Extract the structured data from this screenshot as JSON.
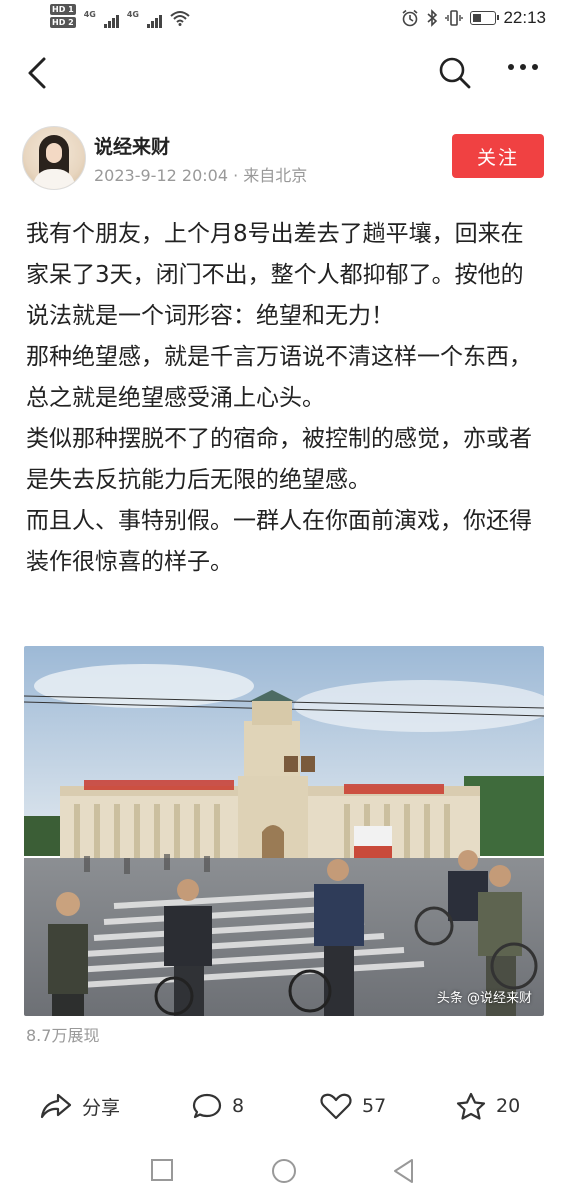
{
  "status_bar": {
    "sim1": "HD 1",
    "sim2": "HD 2",
    "network1": "4G",
    "network2": "4G",
    "time": "22:13"
  },
  "author": {
    "name": "说经来财",
    "meta": "2023-9-12 20:04 · 来自北京",
    "follow_label": "关注"
  },
  "post": {
    "paragraphs": [
      "我有个朋友，上个月8号出差去了趟平壤，回来在家呆了3天，闭门不出，整个人都抑郁了。按他的说法就是一个词形容：绝望和无力！",
      "那种绝望感，就是千言万语说不清这样一个东西，总之就是绝望感受涌上心头。",
      "类似那种摆脱不了的宿命，被控制的感觉，亦或者是失去反抗能力后无限的绝望感。",
      "而且人、事特别假。一群人在你面前演戏，你还得装作很惊喜的样子。"
    ],
    "photo_watermark": "头条 @说经来财",
    "views": "8.7万展现"
  },
  "actions": {
    "share_label": "分享",
    "comment_count": "8",
    "like_count": "57",
    "favorite_count": "20"
  },
  "icons": {
    "back": "back-arrow-icon",
    "search": "search-icon",
    "more": "more-icon",
    "share": "share-icon",
    "comment": "comment-icon",
    "like": "heart-icon",
    "favorite": "star-icon"
  },
  "colors": {
    "follow_button": "#f04142",
    "meta_text": "#999999"
  }
}
